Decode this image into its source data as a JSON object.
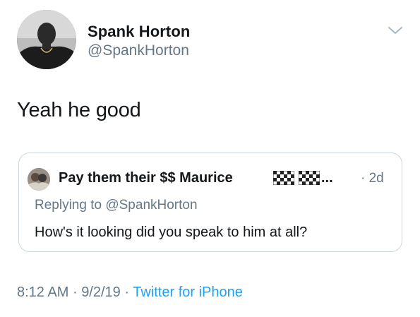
{
  "author": {
    "name": "Spank Horton",
    "handle": "@SpankHorton",
    "avatar_icon": "profile-photo"
  },
  "menu": {
    "icon": "chevron-down-icon"
  },
  "tweet": {
    "text": "Yeah he good"
  },
  "quoted": {
    "name": "Pay them their $$ Maurice",
    "flag_icons": [
      "checkered-flag-icon",
      "checkered-flag-icon"
    ],
    "truncation": "...",
    "time": "2d",
    "time_separator": "·",
    "replying_prefix": "Replying to",
    "replying_handle": "@SpankHorton",
    "text": "How's it looking did you speak to him at all?"
  },
  "meta": {
    "time": "8:12 AM",
    "date": "9/2/19",
    "separator": "·",
    "source": "Twitter for iPhone"
  },
  "colors": {
    "secondary_text": "#657786",
    "link": "#1da1f2",
    "border": "#ccd6dd",
    "primary_text": "#14171a"
  }
}
